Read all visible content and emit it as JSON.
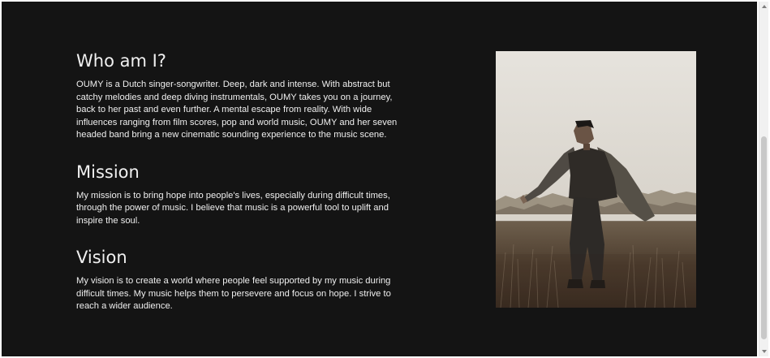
{
  "sections": [
    {
      "title": "Who am I?",
      "body": "OUMY is a Dutch singer-songwriter. Deep, dark and intense. With abstract but catchy melodies and deep diving instrumentals, OUMY takes you on a journey, back to her past and even further. A mental escape from reality. With wide influences ranging from film scores, pop and world music, OUMY and her seven headed band bring a new cinematic sounding experience to the music scene."
    },
    {
      "title": "Mission",
      "body": "My mission is to bring hope into people's lives, especially during difficult times, through the power of music. I believe that music is a powerful tool to uplift and inspire the soul."
    },
    {
      "title": "Vision",
      "body": "My vision is to create a world where people feel supported by my music during difficult times. My music helps them to persevere and focus on hope. I strive to reach a wider audience."
    }
  ],
  "colors": {
    "page_background": "#141414",
    "text": "#f2f2f2"
  }
}
